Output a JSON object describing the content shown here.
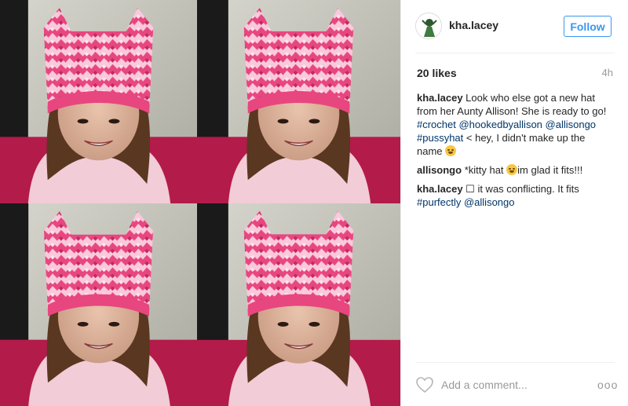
{
  "post": {
    "username": "kha.lacey",
    "follow_label": "Follow",
    "likes": "20 likes",
    "time": "4h",
    "photo_alt": "Four photos of a child wearing a pink and white crocheted cat-ear hat"
  },
  "comments": [
    {
      "user": "kha.lacey",
      "text": "Look who else got a new hat from her Aunty Allison! She is ready to go!",
      "link1": "#crochet @hookedbyallison @allisongo",
      "link2": "#pussyhat",
      "text2": "< hey, I didn't make up the name"
    },
    {
      "user": "allisongo",
      "text": "*kitty hat",
      "text2": "im glad it fits!!!"
    },
    {
      "user": "kha.lacey",
      "text": "☐ it was conflicting. It fits",
      "link1": "#purfectly @allisongo"
    }
  ],
  "add_comment": {
    "placeholder": "Add a comment..."
  },
  "more_label": "ooo",
  "icons": [
    "heart-icon",
    "more-options-icon",
    "avatar"
  ],
  "colors": {
    "accent": "#3897f0",
    "link": "#003569",
    "muted": "#999999",
    "hat_pink": "#e8467f",
    "hat_light": "#f6b7d2"
  }
}
